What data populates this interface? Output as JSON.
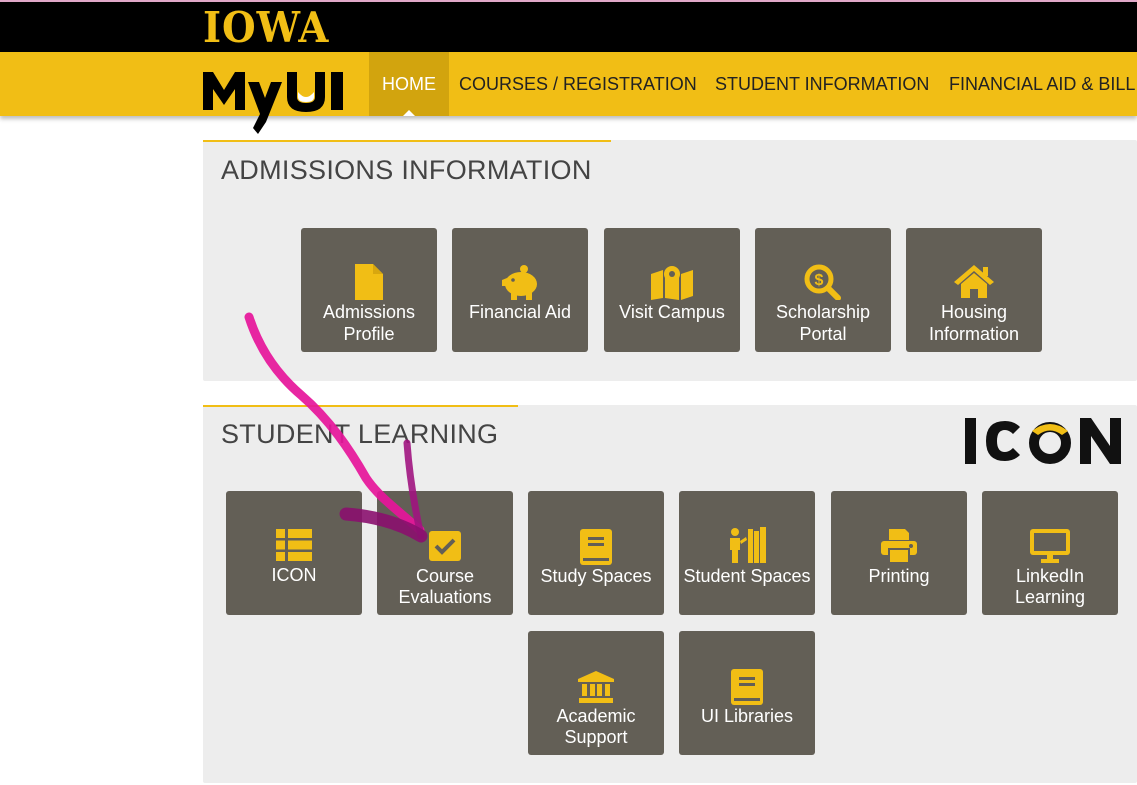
{
  "header": {
    "brand": "IOWA",
    "app_logo": "MyUI",
    "nav": [
      "HOME",
      "COURSES / REGISTRATION",
      "STUDENT INFORMATION",
      "FINANCIAL AID & BILLIN"
    ]
  },
  "admissions": {
    "title": "ADMISSIONS INFORMATION",
    "tiles": [
      {
        "line1": "Admissions",
        "line2": "Profile",
        "icon": "file-icon"
      },
      {
        "line1": "Financial Aid",
        "line2": "",
        "icon": "piggy-bank-icon"
      },
      {
        "line1": "Visit Campus",
        "line2": "",
        "icon": "map-icon"
      },
      {
        "line1": "Scholarship",
        "line2": "Portal",
        "icon": "search-dollar-icon"
      },
      {
        "line1": "Housing",
        "line2": "Information",
        "icon": "home-icon"
      }
    ]
  },
  "learning": {
    "title": "STUDENT LEARNING",
    "logo": "ICON",
    "tiles": [
      {
        "line1": "ICON",
        "line2": "",
        "icon": "list-icon"
      },
      {
        "line1": "Course",
        "line2": "Evaluations",
        "icon": "check-square-icon"
      },
      {
        "line1": "Study Spaces",
        "line2": "",
        "icon": "book-icon"
      },
      {
        "line1": "Student Spaces",
        "line2": "",
        "icon": "student-bookshelf-icon"
      },
      {
        "line1": "Printing",
        "line2": "",
        "icon": "printer-icon"
      },
      {
        "line1": "LinkedIn",
        "line2": "Learning",
        "icon": "monitor-icon"
      },
      {
        "line1": "Academic",
        "line2": "Support",
        "icon": "university-icon"
      },
      {
        "line1": "UI Libraries",
        "line2": "",
        "icon": "book-icon"
      }
    ]
  },
  "colors": {
    "gold": "#f1be15",
    "tile": "#635f56",
    "panel": "#ededed",
    "annotation": "#e6159a"
  }
}
